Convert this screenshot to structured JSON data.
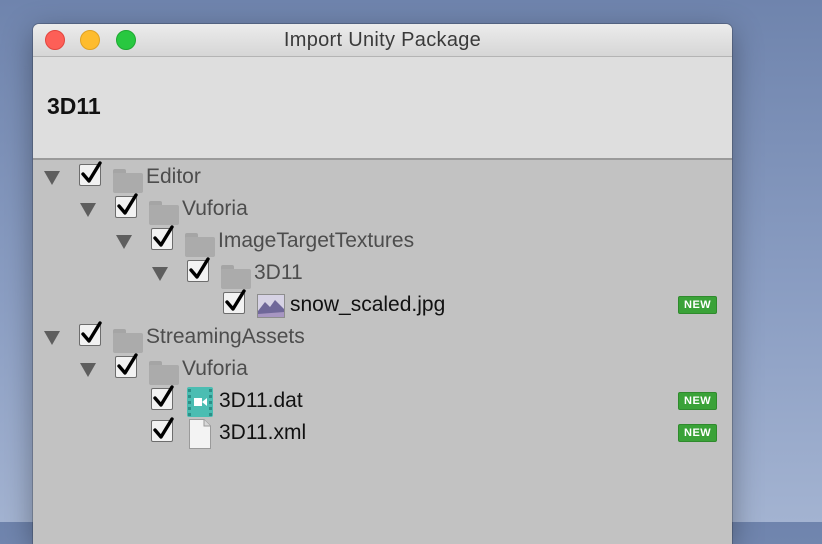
{
  "window": {
    "title": "Import Unity Package"
  },
  "package": {
    "name": "3D11"
  },
  "tree": {
    "editor": {
      "label": "Editor",
      "checked": true,
      "icon": "folder-icon"
    },
    "editor_vuforia": {
      "label": "Vuforia",
      "checked": true,
      "icon": "folder-icon"
    },
    "image_target_textures": {
      "label": "ImageTargetTextures",
      "checked": true,
      "icon": "folder-icon"
    },
    "folder_3d11": {
      "label": "3D11",
      "checked": true,
      "icon": "folder-icon"
    },
    "snow_scaled": {
      "label": "snow_scaled.jpg",
      "checked": true,
      "icon": "image-file-icon",
      "badge": "NEW"
    },
    "streaming_assets": {
      "label": "StreamingAssets",
      "checked": true,
      "icon": "folder-icon"
    },
    "streaming_vuforia": {
      "label": "Vuforia",
      "checked": true,
      "icon": "folder-icon"
    },
    "dat_file": {
      "label": "3D11.dat",
      "checked": true,
      "icon": "video-file-icon",
      "badge": "NEW"
    },
    "xml_file": {
      "label": "3D11.xml",
      "checked": true,
      "icon": "document-file-icon",
      "badge": "NEW"
    }
  },
  "colors": {
    "badge_new": "#3aa238",
    "traffic_close": "#fd5f57",
    "traffic_minimize": "#febc2e",
    "traffic_maximize": "#28c840",
    "dat_icon": "#4bbdb2"
  }
}
